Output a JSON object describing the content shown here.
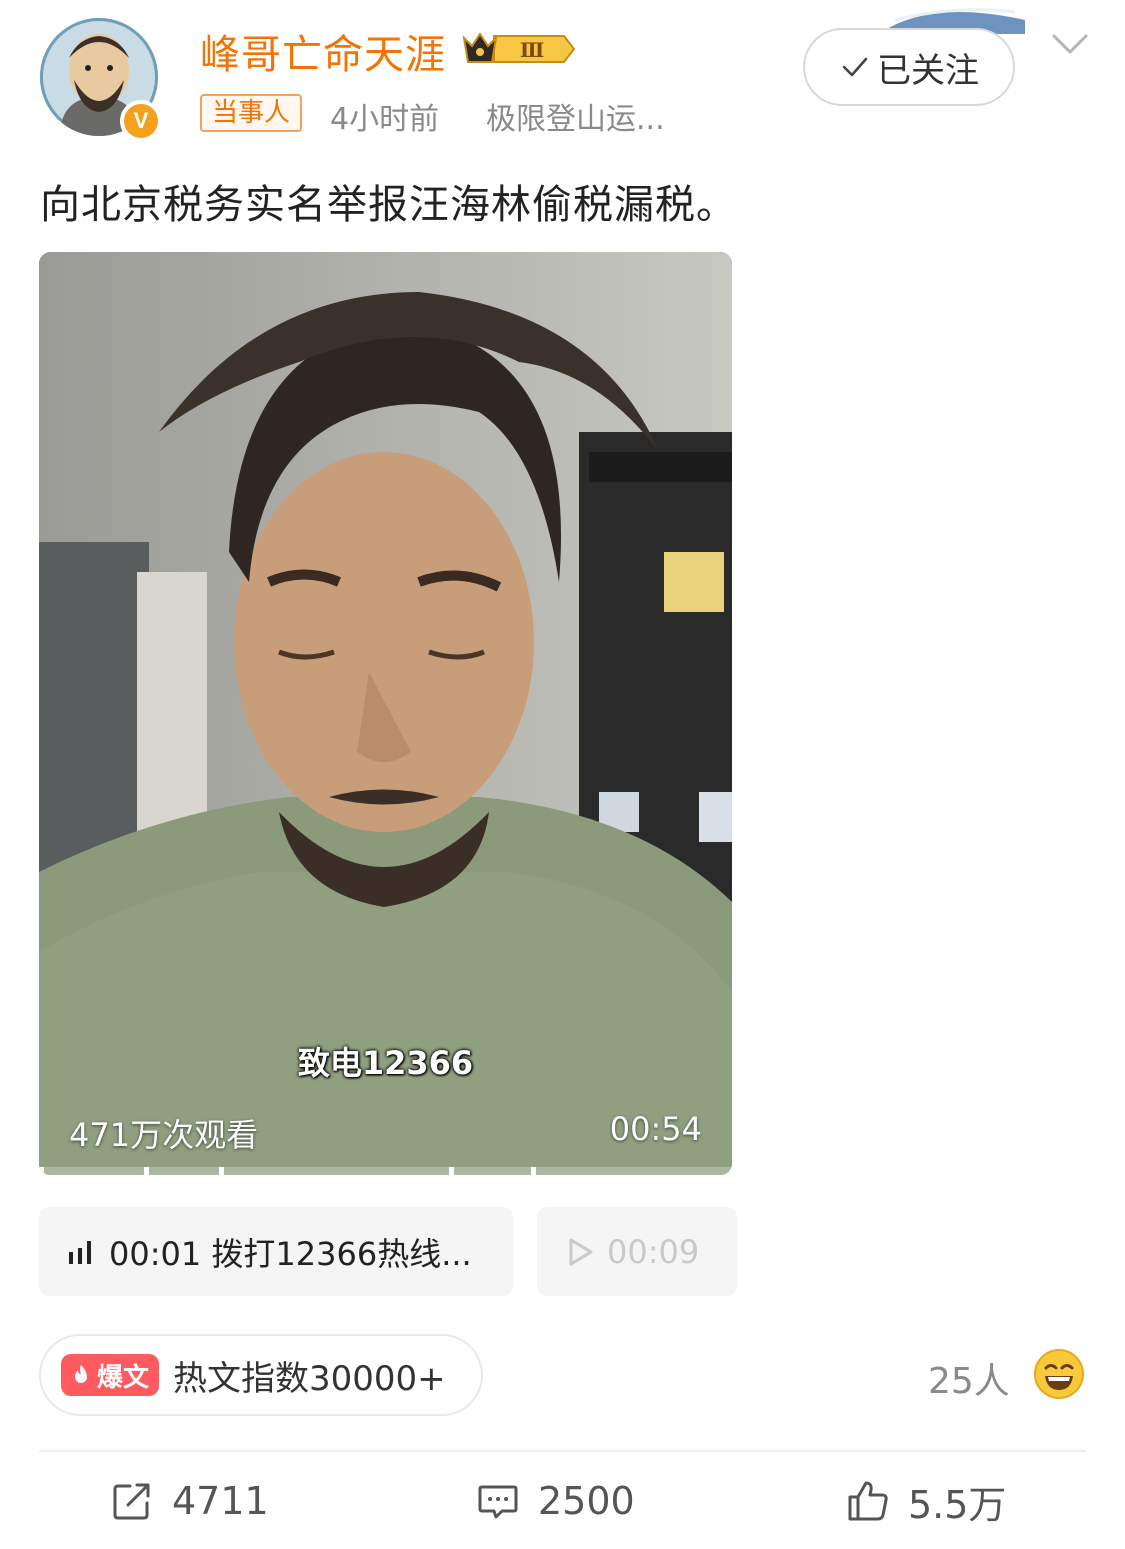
{
  "header": {
    "username": "峰哥亡命天涯",
    "level_badge": "Ⅲ",
    "verified_mark": "V",
    "tag": "当事人",
    "time": "4小时前",
    "source": "极限登山运...",
    "follow_label": "已关注"
  },
  "post": {
    "text": "向北京税务实名举报汪海林偷税漏税。"
  },
  "video": {
    "subtitle": "致电12366",
    "views": "471万次观看",
    "duration": "00:54"
  },
  "chapters": [
    {
      "label": "00:01 拨打12366热线...",
      "state": "playing"
    },
    {
      "label": "00:09",
      "state": "upcoming"
    }
  ],
  "hot": {
    "badge": "爆文",
    "index_text": "热文指数30000+"
  },
  "reactions": {
    "count_text": "25人"
  },
  "actions": {
    "repost": "4711",
    "comment": "2500",
    "like": "5.5万"
  },
  "colors": {
    "username": "#f27405",
    "hot_badge": "#ff5a5f",
    "verified": "#f4a11d"
  }
}
